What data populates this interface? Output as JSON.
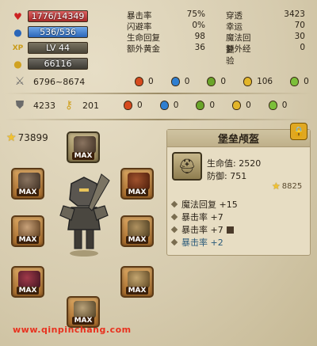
{
  "player": {
    "hp": "1776/14349",
    "mp": "536/536",
    "level": "LV 44",
    "gold": "66116"
  },
  "stats": [
    {
      "name": "暴击率",
      "value": "75%",
      "name2": "穿透",
      "value2": "3423"
    },
    {
      "name": "闪避率",
      "value": "0%",
      "name2": "幸运",
      "value2": "70"
    },
    {
      "name": "生命回复",
      "value": "98",
      "name2": "魔法回复",
      "value2": "30"
    },
    {
      "name": "额外黄金",
      "value": "36",
      "name2": "额外经验",
      "value2": "0"
    }
  ],
  "attack": {
    "range": "6796~8674",
    "elements": [
      {
        "icon": "fire-orb-icon",
        "color": "#d64a1e",
        "value": "0"
      },
      {
        "icon": "water-orb-icon",
        "color": "#2f7fd1",
        "value": "0"
      },
      {
        "icon": "poison-orb-icon",
        "color": "#6aa52a",
        "value": "0"
      },
      {
        "icon": "light-orb-icon",
        "color": "#e2b52a",
        "value": "106"
      },
      {
        "icon": "nature-orb-icon",
        "color": "#7cbf3a",
        "value": "0"
      }
    ]
  },
  "defense": {
    "armor": "4233",
    "resist": "201",
    "elements": [
      {
        "icon": "fire-orb-icon",
        "color": "#d64a1e",
        "value": "0"
      },
      {
        "icon": "water-orb-icon",
        "color": "#2f7fd1",
        "value": "0"
      },
      {
        "icon": "poison-orb-icon",
        "color": "#6aa52a",
        "value": "0"
      },
      {
        "icon": "light-orb-icon",
        "color": "#e2b52a",
        "value": "0"
      },
      {
        "icon": "nature-orb-icon",
        "color": "#7cbf3a",
        "value": "0"
      }
    ]
  },
  "equipment": {
    "total_score": "73899",
    "max_label": "MAX"
  },
  "detail": {
    "title": "堡垒颅盔",
    "hp_label": "生命值: 2520",
    "def_label": "防御: 751",
    "score": "8825",
    "attributes": [
      {
        "text": "魔法回复 +15",
        "highlight": false
      },
      {
        "text": "暴击率 +7",
        "highlight": false
      },
      {
        "text": "暴击率 +7",
        "highlight": false
      },
      {
        "text": "暴击率 +2",
        "highlight": true
      }
    ]
  },
  "watermark": "www.qinpinchang.com"
}
